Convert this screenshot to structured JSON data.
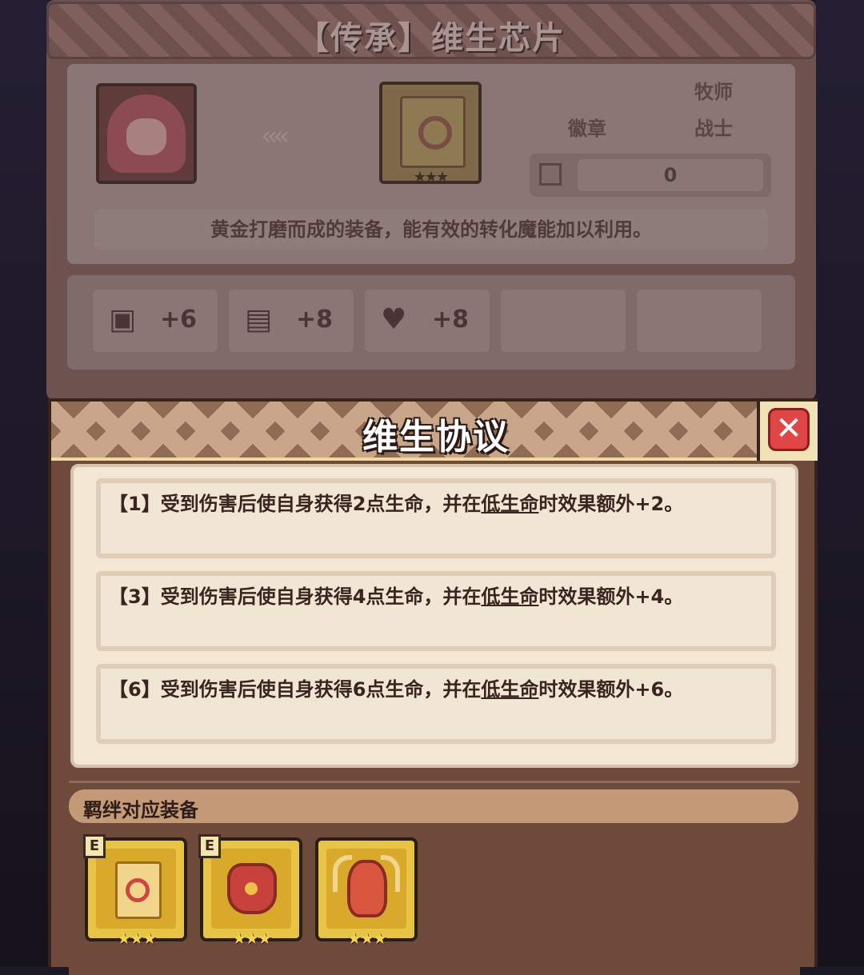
{
  "item": {
    "title": "【传承】维生芯片",
    "arrows": "‹‹‹‹",
    "chip_stars": "★★★",
    "tags": {
      "class_1": "牧师",
      "slot": "徽章",
      "class_2": "战士"
    },
    "count": "0",
    "description": "黄金打磨而成的装备，能有效的转化魔能加以利用。",
    "stats": [
      {
        "icon": "fist-icon",
        "value": "+6"
      },
      {
        "icon": "book-icon",
        "value": "+8"
      },
      {
        "icon": "heart-icon",
        "value": "+8"
      }
    ]
  },
  "modal": {
    "title": "维生协议",
    "close_glyph": "✕",
    "effects": [
      {
        "prefix": "【1】受到伤害后使自身获得2点生命，并在",
        "link": "低生命",
        "suffix": "时效果额外+2。"
      },
      {
        "prefix": "【3】受到伤害后使自身获得4点生命，并在",
        "link": "低生命",
        "suffix": "时效果额外+4。"
      },
      {
        "prefix": "【6】受到伤害后使自身获得6点生命，并在",
        "link": "低生命",
        "suffix": "时效果额外+6。"
      }
    ],
    "bond": {
      "label": "羁绊对应装备",
      "equipment": [
        {
          "name": "vital-chip",
          "badge": "E",
          "stars": "★★★"
        },
        {
          "name": "golden-armor",
          "badge": "E",
          "stars": "★★★"
        },
        {
          "name": "horned-helm",
          "badge": "",
          "stars": "★★★"
        }
      ]
    }
  }
}
